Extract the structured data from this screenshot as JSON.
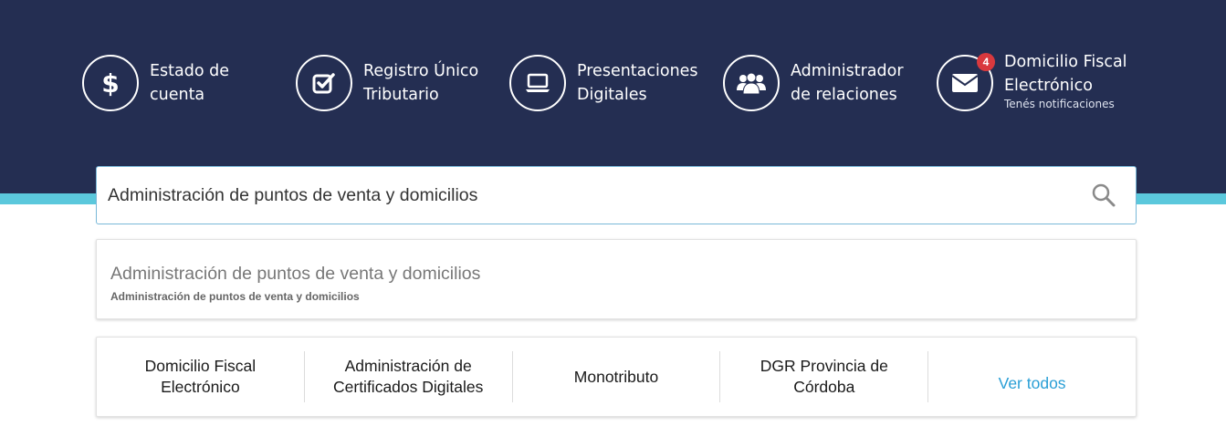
{
  "header": {
    "background": "#242e52",
    "accent_color": "#5bc8dc",
    "shortcuts": [
      {
        "icon": "dollar-icon",
        "label_line1": "Estado de",
        "label_line2": "cuenta"
      },
      {
        "icon": "checkbox-icon",
        "label_line1": "Registro Único",
        "label_line2": "Tributario"
      },
      {
        "icon": "laptop-icon",
        "label_line1": "Presentaciones",
        "label_line2": "Digitales"
      },
      {
        "icon": "users-icon",
        "label_line1": "Administrador",
        "label_line2": "de relaciones"
      },
      {
        "icon": "envelope-icon",
        "label_line1": "Domicilio Fiscal",
        "label_line2": "Electrónico",
        "subtitle": "Tenés notificaciones",
        "badge": "4",
        "badge_color": "#d9393e"
      }
    ]
  },
  "search": {
    "value": "Administración de puntos de venta y domicilios",
    "icon": "search-icon"
  },
  "suggestions": [
    {
      "title": "Administración de puntos de venta y domicilios",
      "subtitle": "Administración de puntos de venta y domicilios"
    }
  ],
  "quick_links": {
    "items": [
      {
        "line1": "Domicilio Fiscal",
        "line2": "Electrónico"
      },
      {
        "line1": "Administración de",
        "line2": "Certificados Digitales"
      },
      {
        "line1": "Monotributo",
        "line2": ""
      },
      {
        "line1": "DGR Provincia de",
        "line2": "Córdoba"
      }
    ],
    "see_all": "Ver todos",
    "link_color": "#2a9fd6"
  }
}
